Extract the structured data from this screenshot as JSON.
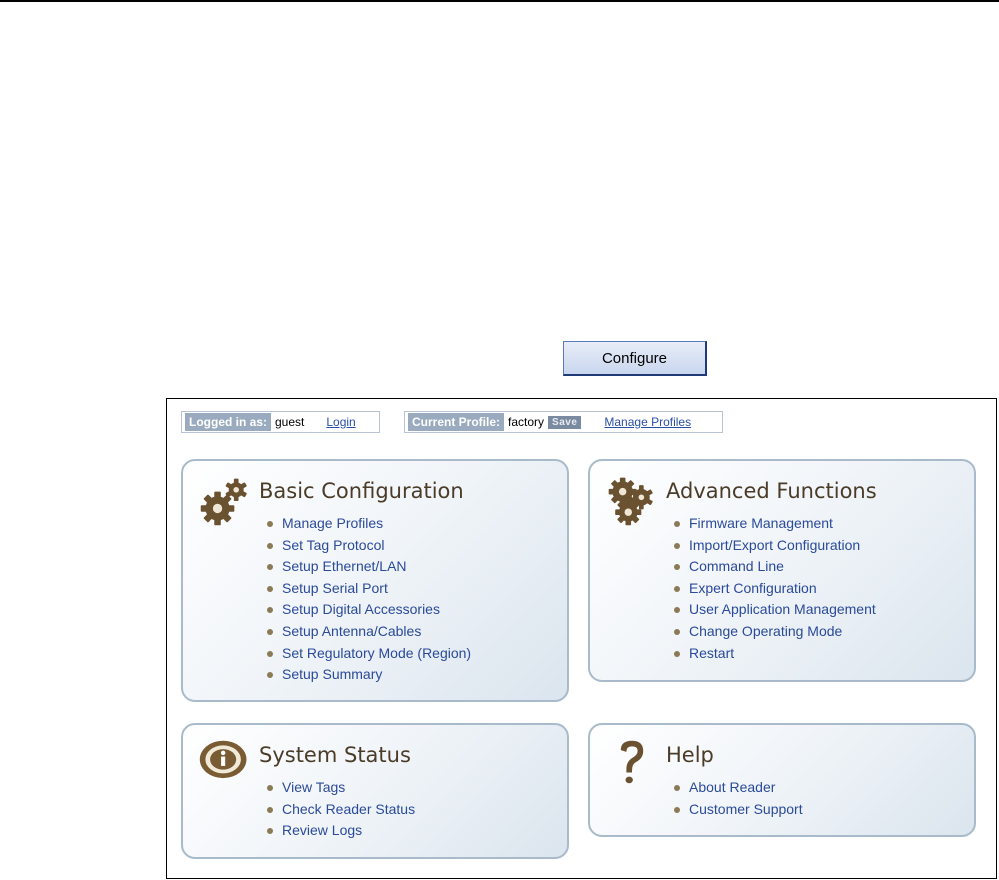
{
  "configure_button": {
    "label": "Configure"
  },
  "status_bar": {
    "logged_in_label": "Logged in as:",
    "user": "guest",
    "login_link": "Login",
    "profile_label": "Current Profile:",
    "profile": "factory",
    "save_label": "Save",
    "manage_link": "Manage Profiles"
  },
  "panels": {
    "basic": {
      "title": "Basic Configuration",
      "icon": "gears-icon",
      "items": [
        "Manage Profiles",
        "Set Tag Protocol",
        "Setup Ethernet/LAN",
        "Setup Serial Port",
        "Setup Digital Accessories",
        "Setup Antenna/Cables",
        "Set Regulatory Mode (Region)",
        "Setup Summary"
      ]
    },
    "advanced": {
      "title": "Advanced Functions",
      "icon": "gear-cluster-icon",
      "items": [
        "Firmware Management",
        "Import/Export Configuration",
        "Command Line",
        "Expert Configuration",
        "User Application Management",
        "Change Operating Mode",
        "Restart"
      ]
    },
    "status": {
      "title": "System Status",
      "icon": "info-icon",
      "items": [
        "View Tags",
        "Check Reader Status",
        "Review Logs"
      ]
    },
    "help": {
      "title": "Help",
      "icon": "question-mark-icon",
      "items": [
        "About Reader",
        "Customer Support"
      ]
    }
  },
  "colors": {
    "link": "#2a4a9a",
    "title": "#4a3c28",
    "panel_border": "#a9bacb",
    "status_tag": "#9aaabf"
  }
}
